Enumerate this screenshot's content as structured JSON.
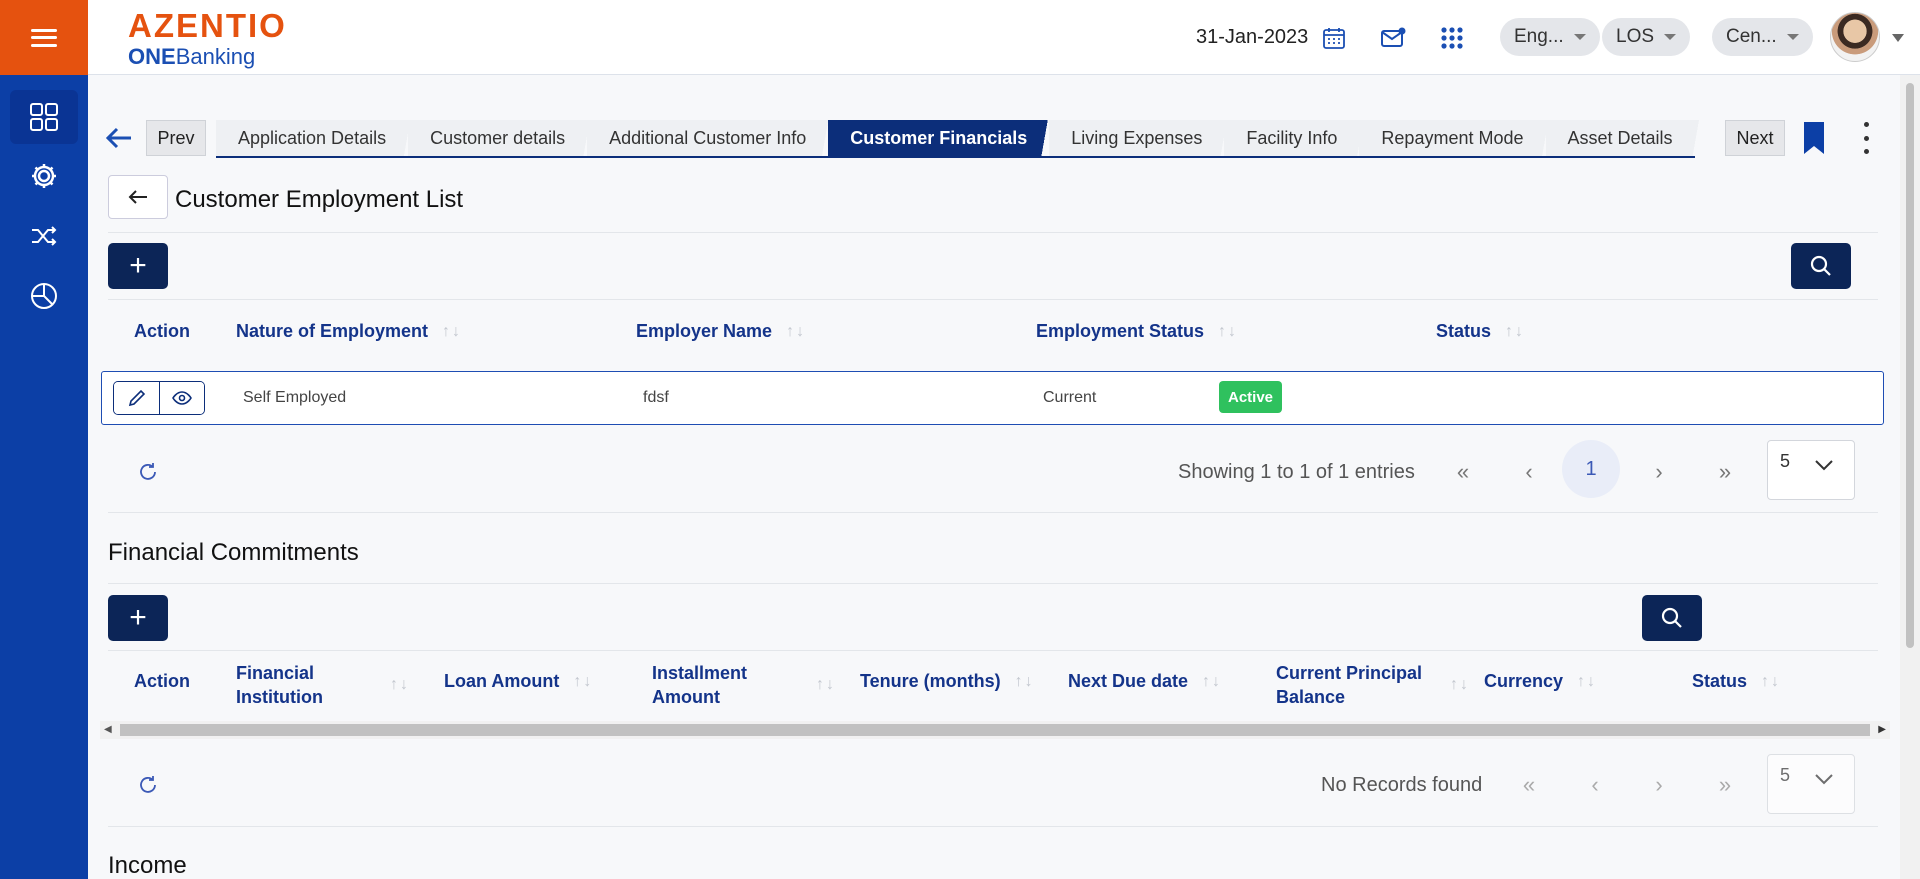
{
  "header": {
    "brand_top": "AZENTIO",
    "brand_bottom_bold": "ONE",
    "brand_bottom": "Banking",
    "date": "31-Jan-2023",
    "language": "Eng...",
    "module": "LOS",
    "branch": "Cen..."
  },
  "tabs": {
    "prev": "Prev",
    "next": "Next",
    "items": [
      "Application Details",
      "Customer details",
      "Additional Customer Info",
      "Customer Financials",
      "Living Expenses",
      "Facility Info",
      "Repayment Mode",
      "Asset Details"
    ],
    "active_index": 3
  },
  "employment": {
    "title": "Customer Employment List",
    "columns": [
      "Action",
      "Nature of Employment",
      "Employer Name",
      "Employment Status",
      "Status"
    ],
    "rows": [
      {
        "nature": "Self Employed",
        "employer": "fdsf",
        "emp_status": "Current",
        "status": "Active"
      }
    ],
    "showing": "Showing 1 to 1 of 1 entries",
    "current_page": "1",
    "page_size": "5"
  },
  "commitments": {
    "title": "Financial Commitments",
    "columns": {
      "action": "Action",
      "institution_1": "Financial",
      "institution_2": "Institution",
      "loan": "Loan Amount",
      "installment_1": "Installment",
      "installment_2": "Amount",
      "tenure": "Tenure (months)",
      "next_due": "Next Due date",
      "principal_1": "Current Principal",
      "principal_2": "Balance",
      "currency": "Currency",
      "status": "Status"
    },
    "empty": "No Records found",
    "page_size": "5"
  },
  "income": {
    "title": "Income"
  },
  "colors": {
    "sidebar": "#0c3fa6",
    "brand_orange": "#e5520f",
    "navy": "#0c2557",
    "active_badge": "#2fc15e"
  }
}
